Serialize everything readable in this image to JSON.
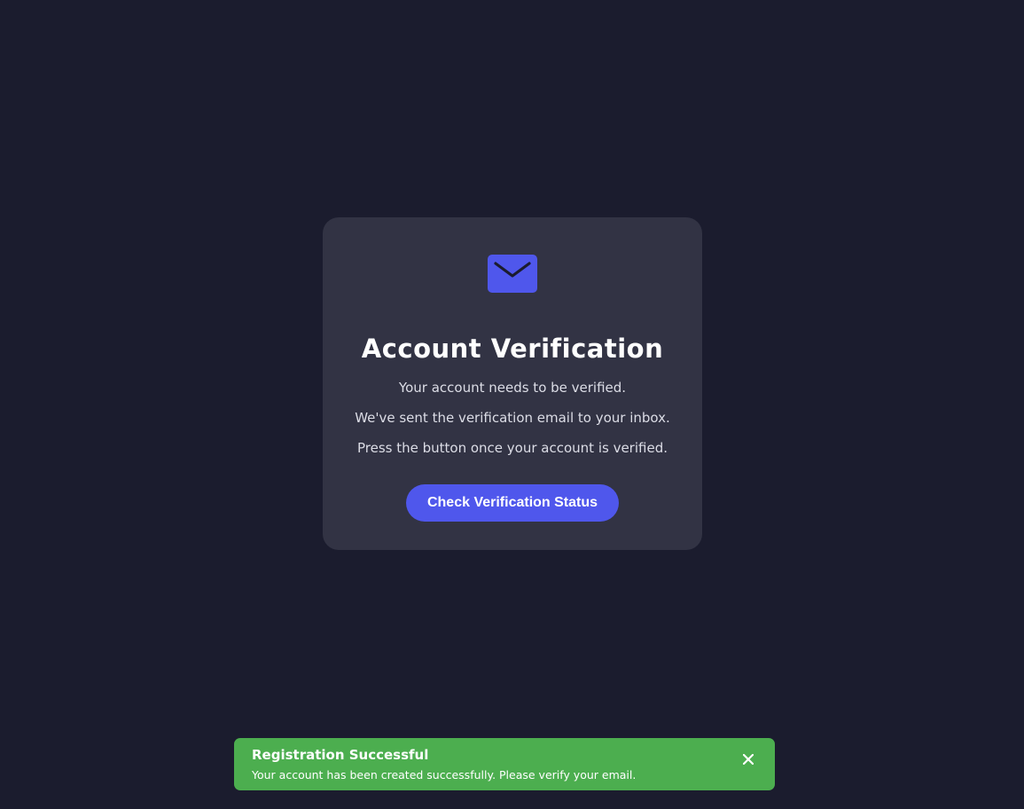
{
  "verification": {
    "icon": "envelope-icon",
    "title": "Account Verification",
    "lines": [
      "Your account needs to be verified.",
      "We've sent the verification email to your inbox.",
      "Press the button once your account is verified."
    ],
    "button_label": "Check Verification Status"
  },
  "toast": {
    "title": "Registration Successful",
    "message": "Your account has been created successfully. Please verify your email.",
    "close_icon": "close-icon"
  },
  "colors": {
    "background": "#1b1c2e",
    "card": "#323344",
    "accent": "#4f57ec",
    "success": "#4cae4f"
  }
}
